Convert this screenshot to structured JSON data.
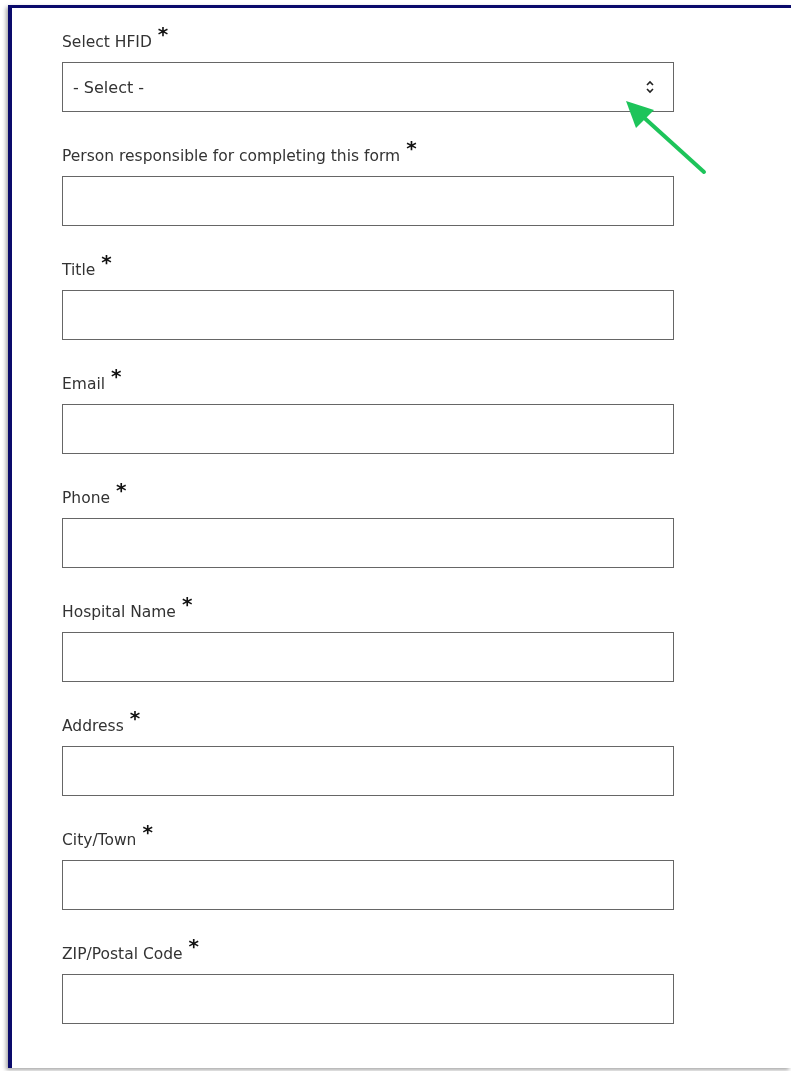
{
  "fields": [
    {
      "label": "Select HFID",
      "required_mark": "*",
      "kind": "select",
      "value": "- Select -"
    },
    {
      "label": "Person responsible for completing this form",
      "required_mark": "*",
      "kind": "text"
    },
    {
      "label": "Title",
      "required_mark": "*",
      "kind": "text"
    },
    {
      "label": "Email",
      "required_mark": "*",
      "kind": "text"
    },
    {
      "label": "Phone",
      "required_mark": "*",
      "kind": "text"
    },
    {
      "label": "Hospital Name",
      "required_mark": "*",
      "kind": "text"
    },
    {
      "label": "Address",
      "required_mark": "*",
      "kind": "text"
    },
    {
      "label": "City/Town",
      "required_mark": "*",
      "kind": "text"
    },
    {
      "label": "ZIP/Postal Code",
      "required_mark": "*",
      "kind": "text"
    }
  ]
}
